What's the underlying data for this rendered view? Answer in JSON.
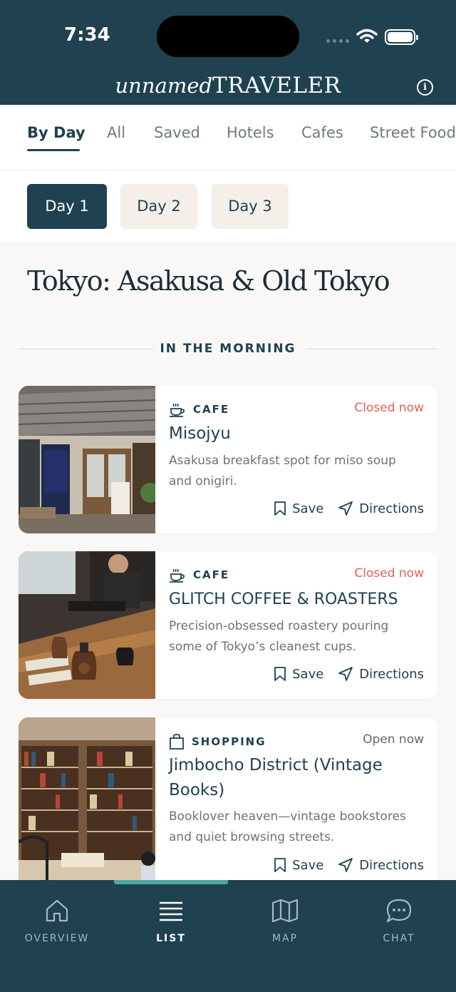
{
  "status_bar": {
    "time": "7:34"
  },
  "header": {
    "brand_italic": "unnamed",
    "brand_caps": "TRAVELER",
    "info_icon": "info-icon"
  },
  "tabs": [
    {
      "label": "By Day",
      "active": true
    },
    {
      "label": "All"
    },
    {
      "label": "Saved"
    },
    {
      "label": "Hotels"
    },
    {
      "label": "Cafes"
    },
    {
      "label": "Street Food"
    }
  ],
  "days": [
    {
      "label": "Day 1",
      "active": true
    },
    {
      "label": "Day 2"
    },
    {
      "label": "Day 3"
    }
  ],
  "page_title": "Tokyo: Asakusa & Old Tokyo",
  "section_label": "IN THE MORNING",
  "places": [
    {
      "category": "CAFE",
      "category_icon": "coffee-cup-icon",
      "status": "Closed now",
      "name": "Misojyu",
      "description": "Asakusa breakfast spot for miso soup and onigiri.",
      "save_label": "Save",
      "directions_label": "Directions"
    },
    {
      "category": "CAFE",
      "category_icon": "coffee-cup-icon",
      "status": "Closed now",
      "name": "GLITCH COFFEE & ROASTERS",
      "description": "Precision-obsessed roastery pouring some of Tokyo’s cleanest cups.",
      "save_label": "Save",
      "directions_label": "Directions"
    },
    {
      "category": "SHOPPING",
      "category_icon": "shopping-bag-icon",
      "status": "Open now",
      "name": "Jimbocho District (Vintage Books)",
      "description": "Booklover heaven—vintage bookstores and quiet browsing streets.",
      "save_label": "Save",
      "directions_label": "Directions"
    }
  ],
  "bottom_nav": [
    {
      "label": "OVERVIEW",
      "icon": "home-icon"
    },
    {
      "label": "LIST",
      "icon": "list-icon",
      "active": true
    },
    {
      "label": "MAP",
      "icon": "map-icon"
    },
    {
      "label": "CHAT",
      "icon": "chat-bubble-icon"
    }
  ],
  "colors": {
    "primary": "#1f4150",
    "accent": "#4fa6a8",
    "closed": "#e36259",
    "chip_bg": "#f4f0e9"
  }
}
